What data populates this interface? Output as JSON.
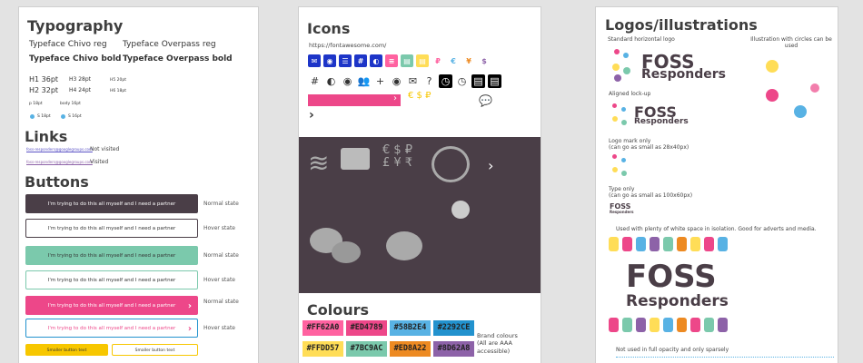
{
  "typography": {
    "title": "Typography",
    "faces": [
      "Typeface Chivo reg",
      "Typeface Overpass reg",
      "Typeface Chivo bold",
      "Typeface Overpass bold"
    ],
    "headings": [
      "H1 36pt",
      "H3 28pt",
      "H5 20pt",
      "H2 32pt",
      "H4 24pt",
      "H6 18pt"
    ],
    "para": [
      "p 18pt",
      "body 16pt"
    ],
    "sizes": [
      "S 18pt",
      "S 16pt"
    ]
  },
  "links": {
    "title": "Links",
    "rows": [
      {
        "link": "foss-responders@googlegroups.com",
        "state": "Not visited"
      },
      {
        "link": "foss-responders@googlegroups.com",
        "state": "Visited"
      }
    ]
  },
  "buttons": {
    "title": "Buttons",
    "label": "I'm trying to do this all myself and I need a partner",
    "states": [
      "Normal state",
      "Hover state",
      "Normal state",
      "Hover state",
      "Normal state",
      "Hover state"
    ],
    "small_label": "Smaller button text"
  },
  "icons": {
    "title": "Icons",
    "url": "https://fontawesome.com/",
    "glyphs_row1": [
      "✉",
      "◉",
      "☰",
      "#",
      "◐",
      "⌗",
      "▤",
      "▤",
      "▢",
      "▢",
      "₽",
      "€",
      "¥",
      "$"
    ],
    "glyphs_row2": [
      "#",
      "▣",
      "◎",
      "👥",
      "+",
      "◉",
      "✉",
      "?",
      "◷",
      "◷",
      "▤",
      "▤"
    ],
    "currency_glyphs": "€ $ ₽ £ ¥ ₹",
    "bar_chevron": "›",
    "chevron": "›"
  },
  "colours": {
    "title": "Colours",
    "swatches": [
      {
        "hex": "#FF62A0",
        "color": "#ff62a0"
      },
      {
        "hex": "#ED4789",
        "color": "#ed4789"
      },
      {
        "hex": "#58B2E4",
        "color": "#58b2e4"
      },
      {
        "hex": "#2292CE",
        "color": "#2292ce"
      },
      {
        "hex": "#FFDD57",
        "color": "#ffdd57"
      },
      {
        "hex": "#7BC9AC",
        "color": "#7bc9ac"
      },
      {
        "hex": "#ED8A22",
        "color": "#ed8a22"
      },
      {
        "hex": "#8D62A8",
        "color": "#8d62a8"
      }
    ],
    "note": "Brand colours\n(All are AAA accessible)"
  },
  "logos": {
    "title": "Logos/illustrations",
    "standard": "Standard horizontal logo",
    "circles": "Illustration with circles can be used",
    "aligned": "Aligned lock-up",
    "mark_only": "Logo mark only\n(can go as small as 28x40px)",
    "type_only": "Type only\n(can go as small as 100x60px)",
    "whitespace": "Used with plenty of white space in isolation. Good for adverts and media.",
    "opacity": "Not used in full opacity and only sparsely",
    "wordmark_1": "FOSS",
    "wordmark_2": "Responders"
  }
}
